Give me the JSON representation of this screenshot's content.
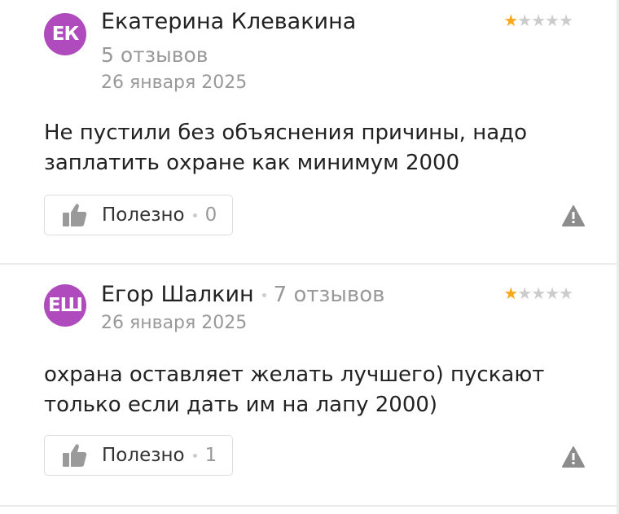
{
  "reviews": [
    {
      "avatar_initials": "ЕК",
      "avatar_color": "#b04bbd",
      "author": "Екатерина Клевакина",
      "reviews_count": "5 отзывов",
      "date": "26 января 2025",
      "rating": 1,
      "rating_max": 5,
      "text": "Не пустили без объяснения причины, надо заплатить охране как минимум 2000",
      "useful_label": "Полезно",
      "useful_count": "0"
    },
    {
      "avatar_initials": "ЕШ",
      "avatar_color": "#b04bbd",
      "author": "Егор Шалкин",
      "reviews_count": "7 отзывов",
      "date": "26 января 2025",
      "rating": 1,
      "rating_max": 5,
      "text": "охрана оставляет желать лучшего) пускают только если дать им на лапу 2000)",
      "useful_label": "Полезно",
      "useful_count": "1"
    }
  ],
  "icons": {
    "useful": "thumbs-up-icon",
    "report": "warning-icon",
    "rating": "star-icon"
  },
  "colors": {
    "star_active": "#f9a81b",
    "star_inactive": "#cccccc",
    "muted_text": "#999999"
  }
}
